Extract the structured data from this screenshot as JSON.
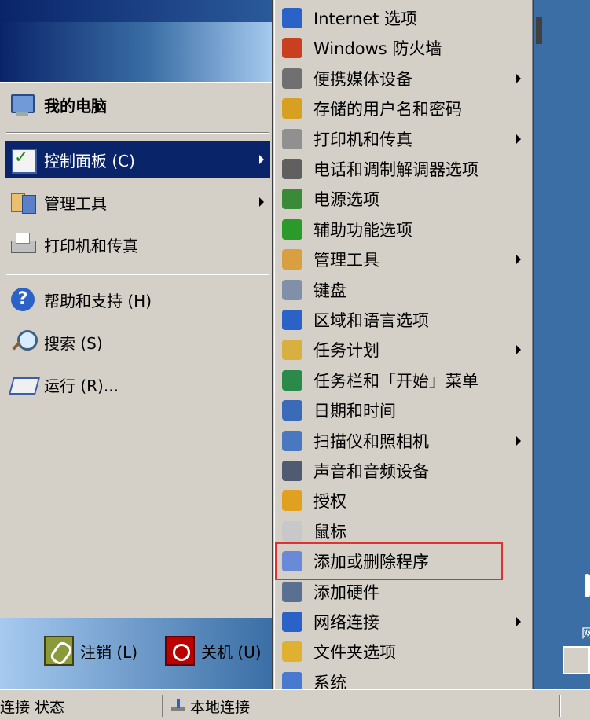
{
  "start_menu": {
    "pinned": [
      {
        "label": "我的电脑",
        "icon": "my-computer-icon"
      }
    ],
    "items": [
      {
        "label": "控制面板 (C)",
        "icon": "control-panel-icon",
        "selected": true,
        "has_submenu": true
      },
      {
        "label": "管理工具",
        "icon": "admin-tools-icon",
        "has_submenu": true
      },
      {
        "label": "打印机和传真",
        "icon": "printer-icon"
      }
    ],
    "bottom_items": [
      {
        "label": "帮助和支持 (H)",
        "icon": "help-icon"
      },
      {
        "label": "搜索 (S)",
        "icon": "search-icon"
      },
      {
        "label": "运行 (R)...",
        "icon": "run-icon"
      }
    ],
    "footer": {
      "logoff_label": "注销 (L)",
      "shutdown_label": "关机 (U)"
    }
  },
  "control_panel_submenu": {
    "items": [
      {
        "label": "Internet 选项",
        "icon": "internet-options-icon",
        "has_submenu": false,
        "color": "#2a62c8"
      },
      {
        "label": "Windows 防火墙",
        "icon": "firewall-icon",
        "has_submenu": false,
        "color": "#c84020"
      },
      {
        "label": "便携媒体设备",
        "icon": "portable-media-icon",
        "has_submenu": true,
        "color": "#707070"
      },
      {
        "label": "存储的用户名和密码",
        "icon": "stored-passwords-icon",
        "has_submenu": false,
        "color": "#d8a020"
      },
      {
        "label": "打印机和传真",
        "icon": "printer-icon",
        "has_submenu": true,
        "color": "#909090"
      },
      {
        "label": "电话和调制解调器选项",
        "icon": "phone-modem-icon",
        "has_submenu": false,
        "color": "#606060"
      },
      {
        "label": "电源选项",
        "icon": "power-options-icon",
        "has_submenu": false,
        "color": "#3a8a3a"
      },
      {
        "label": "辅助功能选项",
        "icon": "accessibility-icon",
        "has_submenu": false,
        "color": "#2a9a2a"
      },
      {
        "label": "管理工具",
        "icon": "admin-tools-icon",
        "has_submenu": true,
        "color": "#d8a040"
      },
      {
        "label": "键盘",
        "icon": "keyboard-icon",
        "has_submenu": false,
        "color": "#8090a8"
      },
      {
        "label": "区域和语言选项",
        "icon": "region-language-icon",
        "has_submenu": false,
        "color": "#2a62c8"
      },
      {
        "label": "任务计划",
        "icon": "scheduled-tasks-icon",
        "has_submenu": true,
        "color": "#d8b040"
      },
      {
        "label": "任务栏和「开始」菜单",
        "icon": "taskbar-start-icon",
        "has_submenu": false,
        "color": "#2a8a4a"
      },
      {
        "label": "日期和时间",
        "icon": "date-time-icon",
        "has_submenu": false,
        "color": "#3a6ab8"
      },
      {
        "label": "扫描仪和照相机",
        "icon": "scanner-camera-icon",
        "has_submenu": true,
        "color": "#4a78c0"
      },
      {
        "label": "声音和音频设备",
        "icon": "sound-audio-icon",
        "has_submenu": false,
        "color": "#505a70"
      },
      {
        "label": "授权",
        "icon": "licensing-icon",
        "has_submenu": false,
        "color": "#e0a020"
      },
      {
        "label": "鼠标",
        "icon": "mouse-icon",
        "has_submenu": false,
        "color": "#c8c8c8"
      },
      {
        "label": "添加或删除程序",
        "icon": "add-remove-programs-icon",
        "has_submenu": false,
        "color": "#6a8ad8",
        "highlighted": true
      },
      {
        "label": "添加硬件",
        "icon": "add-hardware-icon",
        "has_submenu": false,
        "color": "#5a7090"
      },
      {
        "label": "网络连接",
        "icon": "network-connections-icon",
        "has_submenu": true,
        "color": "#2a62c8"
      },
      {
        "label": "文件夹选项",
        "icon": "folder-options-icon",
        "has_submenu": false,
        "color": "#e0b030"
      },
      {
        "label": "系统",
        "icon": "system-icon",
        "has_submenu": false,
        "color": "#4a7ad0"
      }
    ]
  },
  "taskbar": {
    "buttons": [
      {
        "label": "连接 状态"
      },
      {
        "label": "本地连接",
        "icon": "network-icon"
      }
    ]
  },
  "colors": {
    "desktop": "#3a6ea5",
    "menu_bg": "#d4d0c8",
    "selection": "#0a246a",
    "highlight_border": "#e03030"
  }
}
